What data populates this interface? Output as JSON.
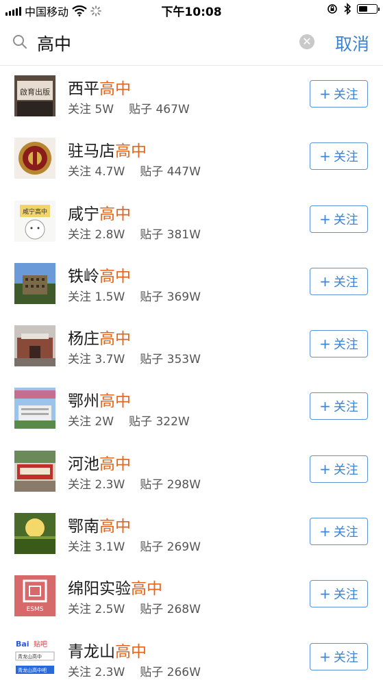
{
  "status": {
    "carrier": "中国移动",
    "time": "下午10:08"
  },
  "search": {
    "query": "高中",
    "cancel_label": "取消"
  },
  "labels": {
    "follow_prefix": "关注",
    "posts_prefix": "贴子",
    "follow_button": "关注",
    "follow_plus": "+"
  },
  "results": [
    {
      "name": "西平",
      "highlight": "高中",
      "followers": "5W",
      "posts": "467W"
    },
    {
      "name": "驻马店",
      "highlight": "高中",
      "followers": "4.7W",
      "posts": "447W"
    },
    {
      "name": "咸宁",
      "highlight": "高中",
      "followers": "2.8W",
      "posts": "381W"
    },
    {
      "name": "铁岭",
      "highlight": "高中",
      "followers": "1.5W",
      "posts": "369W"
    },
    {
      "name": "杨庄",
      "highlight": "高中",
      "followers": "3.7W",
      "posts": "353W"
    },
    {
      "name": "鄂州",
      "highlight": "高中",
      "followers": "2W",
      "posts": "322W"
    },
    {
      "name": "河池",
      "highlight": "高中",
      "followers": "2.3W",
      "posts": "298W"
    },
    {
      "name": "鄂南",
      "highlight": "高中",
      "followers": "3.1W",
      "posts": "269W"
    },
    {
      "name": "绵阳实验",
      "highlight": "高中",
      "followers": "2.5W",
      "posts": "268W"
    },
    {
      "name": "青龙山",
      "highlight": "高中",
      "followers": "2.3W",
      "posts": "266W"
    }
  ],
  "thumb_text": {
    "r0": "啟育出版",
    "r2": "咸宁高中",
    "r8": "ESMS",
    "r9_logo": "Bai",
    "r9_logo2": "贴吧",
    "r9_line1": "青龙山高中",
    "r9_line2": "青龙山高中吧"
  },
  "colors": {
    "accent": "#3c83d3",
    "highlight": "#e2651d"
  }
}
